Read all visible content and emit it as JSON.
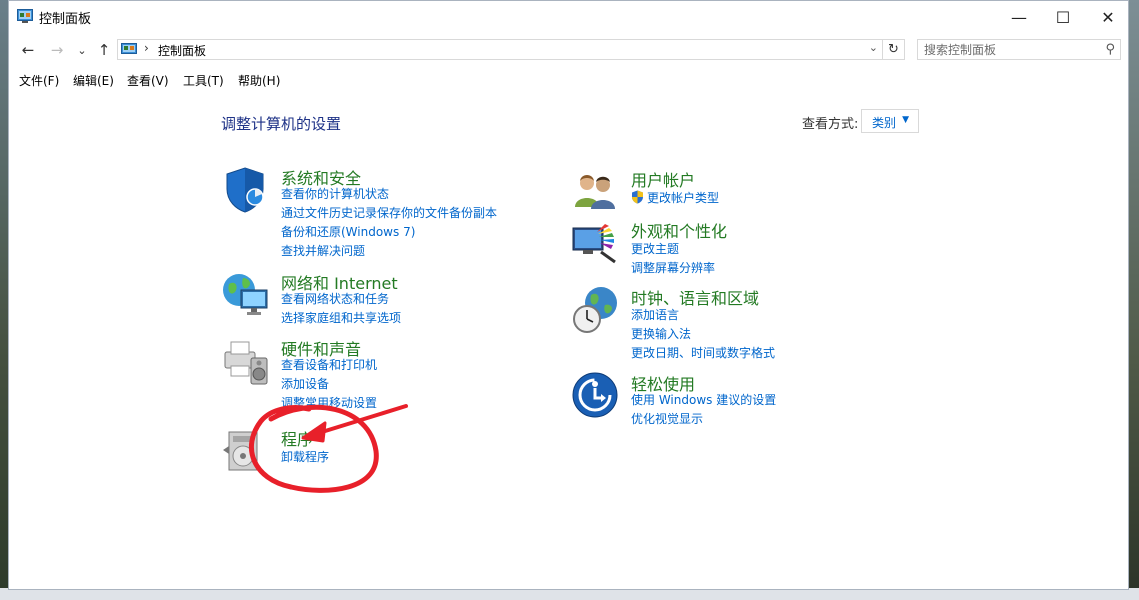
{
  "window": {
    "title": "控制面板"
  },
  "addressbar": {
    "back_icon": "←",
    "forward_icon": "→",
    "recent_icon": "⌄",
    "up_icon": "↑",
    "separator": "›",
    "path": "控制面板",
    "dropdown_icon": "⌄",
    "refresh_icon": "↻",
    "search_placeholder": "搜索控制面板",
    "search_icon": "⚲"
  },
  "caption": {
    "minimize": "—",
    "maximize": "☐",
    "close": "✕"
  },
  "menubar": {
    "file": "文件(F)",
    "edit": "编辑(E)",
    "view": "查看(V)",
    "tools": "工具(T)",
    "help": "帮助(H)"
  },
  "main": {
    "title": "调整计算机的设置",
    "view_by_label": "查看方式:",
    "view_by_value": "类别",
    "view_by_arrow": "▼"
  },
  "categories": {
    "system": {
      "title": "系统和安全",
      "links": [
        "查看你的计算机状态",
        "通过文件历史记录保存你的文件备份副本",
        "备份和还原(Windows 7)",
        "查找并解决问题"
      ]
    },
    "network": {
      "title": "网络和 Internet",
      "links": [
        "查看网络状态和任务",
        "选择家庭组和共享选项"
      ]
    },
    "hardware": {
      "title": "硬件和声音",
      "links": [
        "查看设备和打印机",
        "添加设备",
        "调整常用移动设置"
      ]
    },
    "programs": {
      "title": "程序",
      "links": [
        "卸载程序"
      ]
    },
    "users": {
      "title": "用户帐户",
      "links": [
        "更改帐户类型"
      ]
    },
    "appearance": {
      "title": "外观和个性化",
      "links": [
        "更改主题",
        "调整屏幕分辨率"
      ]
    },
    "clock": {
      "title": "时钟、语言和区域",
      "links": [
        "添加语言",
        "更换输入法",
        "更改日期、时间或数字格式"
      ]
    },
    "ease": {
      "title": "轻松使用",
      "links": [
        "使用 Windows 建议的设置",
        "优化视觉显示"
      ]
    }
  },
  "colors": {
    "category_title": "#237a23",
    "link": "#0066cc",
    "page_title": "#1e3287",
    "annotation": "#e8202a"
  }
}
